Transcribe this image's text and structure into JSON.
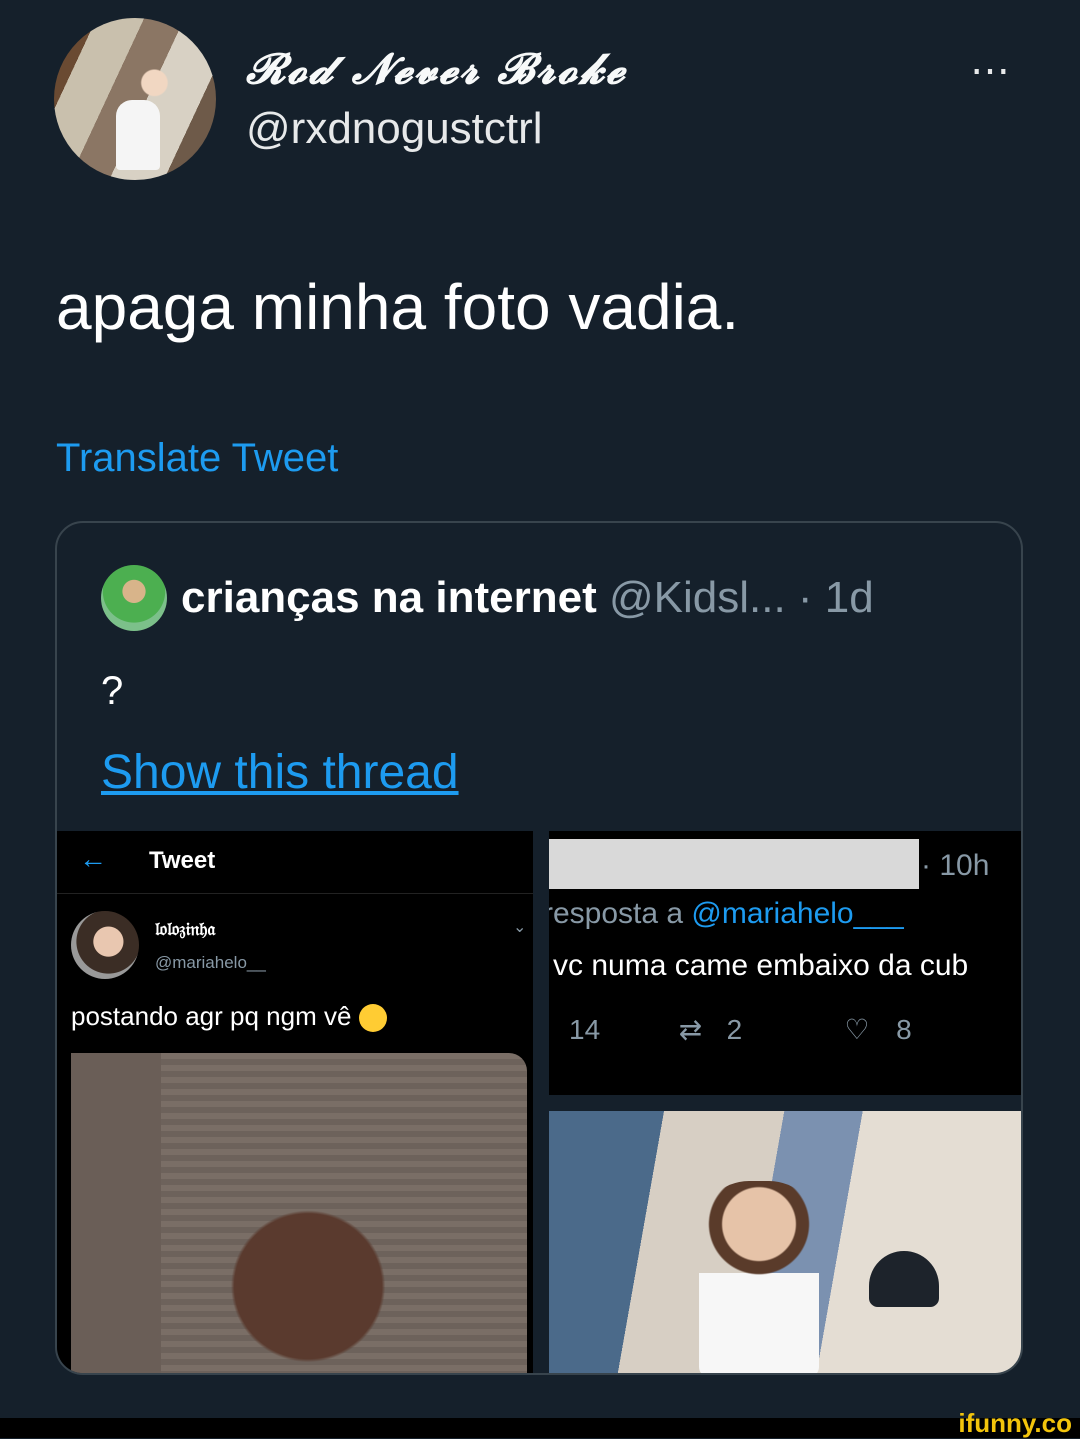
{
  "header": {
    "display_name": "𝓡𝓸𝓭 𝓝𝓮𝓿𝓮𝓻 𝓑𝓻𝓸𝓴𝓮",
    "handle": "@rxdnogustctrl",
    "more_icon": "⋯"
  },
  "tweet": {
    "text": "apaga minha foto vadia.",
    "translate_label": "Translate Tweet"
  },
  "quote": {
    "name": "crianças na internet",
    "meta": " @Kidsl... · 1d",
    "text": "?",
    "show_thread_label": "Show this thread",
    "left_image": {
      "title": "Tweet",
      "back_icon": "←",
      "name": "𝔩𝔬𝔩𝔬𝔷𝔦𝔫𝔥𝔞",
      "handle": "@mariahelo__",
      "chevron_icon": "⌄",
      "text": "postando agr pq ngm vê"
    },
    "right_top_image": {
      "time": "· 10h",
      "reply_prefix": "resposta a ",
      "reply_mention": "@mariahelo___",
      "text": "vc numa came embaixo da cub",
      "reply_count": "14",
      "retweet_icon": "⇄",
      "retweet_count": "2",
      "like_icon": "♡",
      "like_count": "8"
    }
  },
  "watermark": "ifunny.co"
}
